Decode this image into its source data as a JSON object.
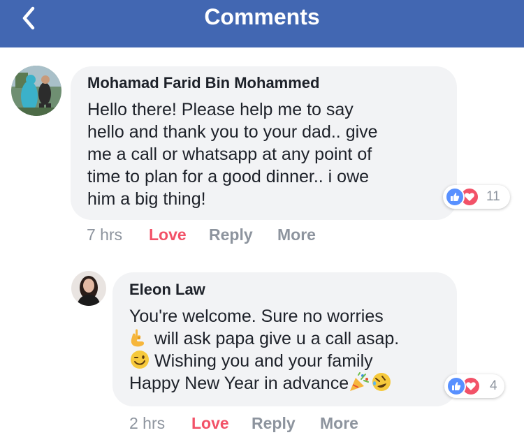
{
  "header": {
    "title": "Comments",
    "back_icon": "chevron-left-icon",
    "color": "#4267b2"
  },
  "colors": {
    "bubble": "#f2f3f5",
    "love_action": "#f25268",
    "muted": "#8d949e",
    "like_reaction": "#5890ff",
    "love_reaction": "#f25268"
  },
  "comments": [
    {
      "author": "Mohamad Farid Bin Mohammed",
      "avatar_icon": "user-avatar-photo",
      "lines": [
        "Hello there! Please help me to say",
        "hello and thank you to your dad.. give",
        "me a call or whatsapp at any point of",
        "time to plan for a good dinner.. i owe",
        "him a big thing!"
      ],
      "reaction_icons": [
        "like-reaction-icon",
        "love-reaction-icon"
      ],
      "reaction_count": "11",
      "time": "7 hrs",
      "love_label": "Love",
      "reply_label": "Reply",
      "more_label": "More"
    },
    {
      "author": "Eleon Law",
      "avatar_icon": "user-avatar-photo",
      "lines": [
        "You're welcome. Sure no worries",
        "will ask papa give u a call asap.",
        "Wishing you and your family",
        "Happy New Year in advance"
      ],
      "emojis": [
        "ok-hand-emoji",
        "winking-face-emoji",
        "party-popper-emoji",
        "rolling-laughing-emoji"
      ],
      "reaction_icons": [
        "like-reaction-icon",
        "love-reaction-icon"
      ],
      "reaction_count": "4",
      "time": "2 hrs",
      "love_label": "Love",
      "reply_label": "Reply",
      "more_label": "More"
    }
  ]
}
